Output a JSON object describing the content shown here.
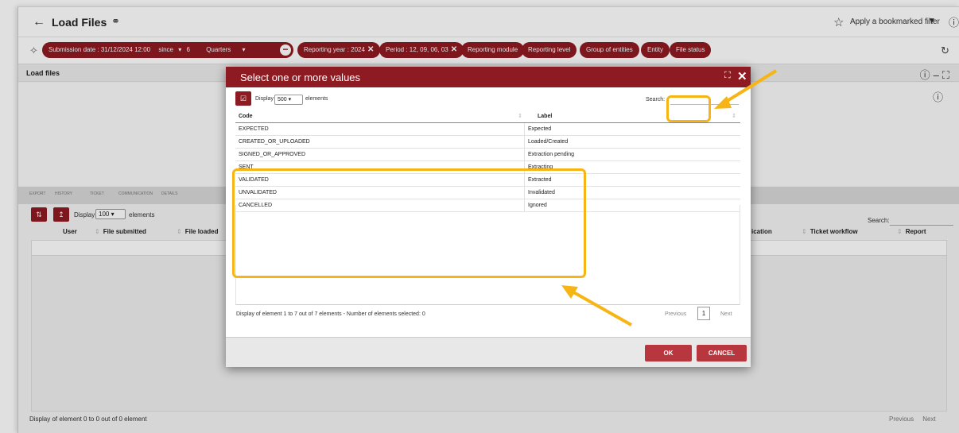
{
  "header": {
    "title": "Load Files",
    "bookmark_filter": "Apply a bookmarked filter"
  },
  "filters": {
    "submission": "Submission date :  31/12/2024 12:00",
    "since": "since",
    "since_value": "6",
    "period_unit": "Quarters",
    "reporting_year": "Reporting year : 2024",
    "period": "Period : 12, 09, 06, 03",
    "reporting_module": "Reporting module",
    "reporting_level": "Reporting level",
    "group_of_entities": "Group of entities",
    "entity": "Entity",
    "file_status": "File status"
  },
  "panel": {
    "title": "Load files",
    "tools": [
      "EXPORT",
      "HISTORY",
      "TICKET",
      "COMMUNICATION",
      "DETAILS"
    ],
    "display_label": "Display",
    "display_value": "100",
    "elements_label": "elements",
    "search_label": "Search:",
    "columns": {
      "user": "User",
      "file_submitted": "File submitted",
      "file_loaded": "File loaded",
      "ication": "ication",
      "ticket_workflow": "Ticket workflow",
      "report": "Report"
    },
    "footer": "Display of element 0 to 0 out of 0 element",
    "previous": "Previous",
    "next": "Next"
  },
  "modal": {
    "title": "Select one or more values",
    "display_label": "Display",
    "display_value": "500",
    "elements_label": "elements",
    "search_label": "Search:",
    "col_code": "Code",
    "col_label": "Label",
    "rows": [
      {
        "code": "EXPECTED",
        "label": "Expected"
      },
      {
        "code": "CREATED_OR_UPLOADED",
        "label": "Loaded/Created"
      },
      {
        "code": "SIGNED_OR_APPROVED",
        "label": "Extraction pending"
      },
      {
        "code": "SENT",
        "label": "Extracting"
      },
      {
        "code": "VALIDATED",
        "label": "Extracted"
      },
      {
        "code": "UNVALIDATED",
        "label": "Invalidated"
      },
      {
        "code": "CANCELLED",
        "label": "Ignored"
      }
    ],
    "footer_info": "Display of element 1 to 7 out of 7 elements  -  Number of elements selected: 0",
    "previous": "Previous",
    "page": "1",
    "next": "Next",
    "ok": "OK",
    "cancel": "CANCEL"
  },
  "colors": {
    "brand": "#8f1b22",
    "highlight": "#f7b515"
  }
}
